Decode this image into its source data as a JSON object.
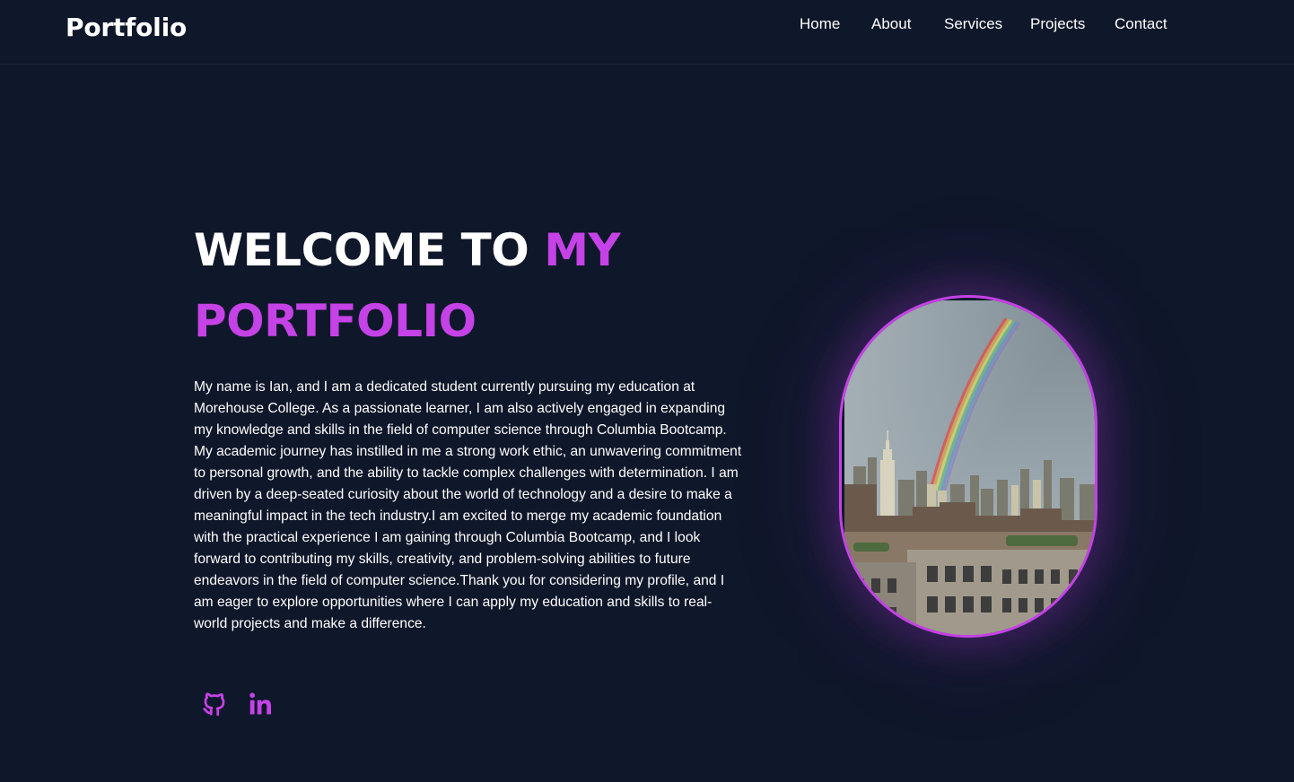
{
  "header": {
    "logo": "Portfolio",
    "nav": [
      "Home",
      "About",
      "Services",
      "Projects",
      "Contact"
    ]
  },
  "hero": {
    "headline_white": "WELCOME TO ",
    "headline_accent": "MY PORTFOLIO",
    "bio": "My name is Ian, and I am a dedicated student currently pursuing my education at Morehouse College. As a passionate learner, I am also actively engaged in expanding my knowledge and skills in the field of computer science through Columbia Bootcamp. My academic journey has instilled in me a strong work ethic, an unwavering commitment to personal growth, and the ability to tackle complex challenges with determination. I am driven by a deep-seated curiosity about the world of technology and a desire to make a meaningful impact in the tech industry.I am excited to merge my academic foundation with the practical experience I am gaining through Columbia Bootcamp, and I look forward to contributing my skills, creativity, and problem-solving abilities to future endeavors in the field of computer science.Thank you for considering my profile, and I am eager to explore opportunities where I can apply my education and skills to real-world projects and make a difference.",
    "socials": [
      {
        "name": "github",
        "icon": "github-icon"
      },
      {
        "name": "linkedin",
        "icon": "linkedin-icon"
      }
    ]
  },
  "portrait": {
    "subject": "city skyline with rainbow"
  },
  "colors": {
    "background": "#0f172a",
    "accent": "#c542e6",
    "text": "#ffffff"
  }
}
